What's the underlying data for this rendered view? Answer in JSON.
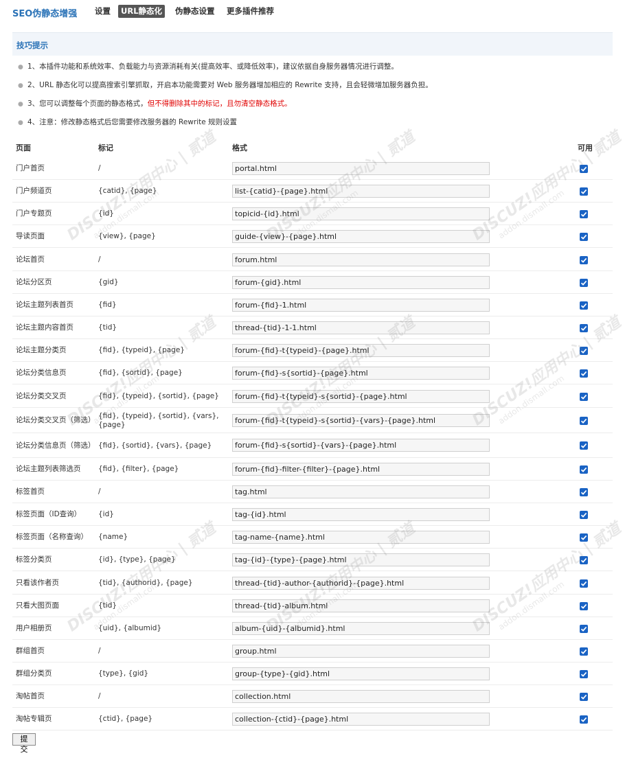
{
  "brand": "SEO伪静态增强",
  "nav": [
    {
      "label": "设置",
      "active": false
    },
    {
      "label": "URL静态化",
      "active": true
    },
    {
      "label": "伪静态设置",
      "active": false
    },
    {
      "label": "更多插件推荐",
      "active": false
    }
  ],
  "tips": {
    "title": "技巧提示",
    "items": [
      "1、本插件功能和系统效率、负载能力与资源消耗有关(提高效率、或降低效率)，建议依据自身服务器情况进行调整。",
      "2、URL 静态化可以提高搜索引擎抓取，开启本功能需要对 Web 服务器增加相应的 Rewrite 支持，且会轻微增加服务器负担。",
      "3、您可以调整每个页面的静态格式，",
      "4、注意：修改静态格式后您需要修改服务器的 Rewrite 规则设置"
    ],
    "item3_warning": "但不得删除其中的标记，且勿清空静态格式。"
  },
  "table": {
    "headers": {
      "page": "页面",
      "mark": "标记",
      "format": "格式",
      "enabled": "可用"
    },
    "rows": [
      {
        "page": "门户首页",
        "mark": "/",
        "format": "portal.html",
        "enabled": true
      },
      {
        "page": "门户频道页",
        "mark": "{catid}, {page}",
        "format": "list-{catid}-{page}.html",
        "enabled": true
      },
      {
        "page": "门户专题页",
        "mark": "{id}",
        "format": "topicid-{id}.html",
        "enabled": true
      },
      {
        "page": "导读页面",
        "mark": "{view}, {page}",
        "format": "guide-{view}-{page}.html",
        "enabled": true
      },
      {
        "page": "论坛首页",
        "mark": "/",
        "format": "forum.html",
        "enabled": true
      },
      {
        "page": "论坛分区页",
        "mark": "{gid}",
        "format": "forum-{gid}.html",
        "enabled": true
      },
      {
        "page": "论坛主题列表首页",
        "mark": "{fid}",
        "format": "forum-{fid}-1.html",
        "enabled": true
      },
      {
        "page": "论坛主题内容首页",
        "mark": "{tid}",
        "format": "thread-{tid}-1-1.html",
        "enabled": true
      },
      {
        "page": "论坛主题分类页",
        "mark": "{fid}, {typeid}, {page}",
        "format": "forum-{fid}-t{typeid}-{page}.html",
        "enabled": true
      },
      {
        "page": "论坛分类信息页",
        "mark": "{fid}, {sortid}, {page}",
        "format": "forum-{fid}-s{sortid}-{page}.html",
        "enabled": true
      },
      {
        "page": "论坛分类交叉页",
        "mark": "{fid}, {typeid}, {sortid}, {page}",
        "format": "forum-{fid}-t{typeid}-s{sortid}-{page}.html",
        "enabled": true
      },
      {
        "page": "论坛分类交叉页（筛选）",
        "mark": "{fid}, {typeid}, {sortid}, {vars}, {page}",
        "format": "forum-{fid}-t{typeid}-s{sortid}-{vars}-{page}.html",
        "enabled": true
      },
      {
        "page": "论坛分类信息页（筛选）",
        "mark": "{fid}, {sortid}, {vars}, {page}",
        "format": "forum-{fid}-s{sortid}-{vars}-{page}.html",
        "enabled": true
      },
      {
        "page": "论坛主题列表筛选页",
        "mark": "{fid}, {filter}, {page}",
        "format": "forum-{fid}-filter-{filter}-{page}.html",
        "enabled": true
      },
      {
        "page": "标签首页",
        "mark": "/",
        "format": "tag.html",
        "enabled": true
      },
      {
        "page": "标签页面（ID查询）",
        "mark": "{id}",
        "format": "tag-{id}.html",
        "enabled": true
      },
      {
        "page": "标签页面（名称查询）",
        "mark": "{name}",
        "format": "tag-name-{name}.html",
        "enabled": true
      },
      {
        "page": "标签分类页",
        "mark": "{id}, {type}, {page}",
        "format": "tag-{id}-{type}-{page}.html",
        "enabled": true
      },
      {
        "page": "只看该作者页",
        "mark": "{tid}, {authorid}, {page}",
        "format": "thread-{tid}-author-{authorid}-{page}.html",
        "enabled": true
      },
      {
        "page": "只看大图页面",
        "mark": "{tid}",
        "format": "thread-{tid}-album.html",
        "enabled": true
      },
      {
        "page": "用户相册页",
        "mark": "{uid}, {albumid}",
        "format": "album-{uid}-{albumid}.html",
        "enabled": true
      },
      {
        "page": "群组首页",
        "mark": "/",
        "format": "group.html",
        "enabled": true
      },
      {
        "page": "群组分类页",
        "mark": "{type}, {gid}",
        "format": "group-{type}-{gid}.html",
        "enabled": true
      },
      {
        "page": "淘帖首页",
        "mark": "/",
        "format": "collection.html",
        "enabled": true
      },
      {
        "page": "淘帖专辑页",
        "mark": "{ctid}, {page}",
        "format": "collection-{ctid}-{page}.html",
        "enabled": true
      }
    ]
  },
  "submit_label": "提交",
  "watermark": {
    "brand": "DISCUZ!应用中心",
    "url": "addon.dismall.com",
    "mark": "贰道"
  },
  "colors": {
    "brand": "#2b73b7",
    "checkbox": "#1a63c4",
    "warning": "#e00000",
    "tips_bg": "#f1f5fa"
  }
}
